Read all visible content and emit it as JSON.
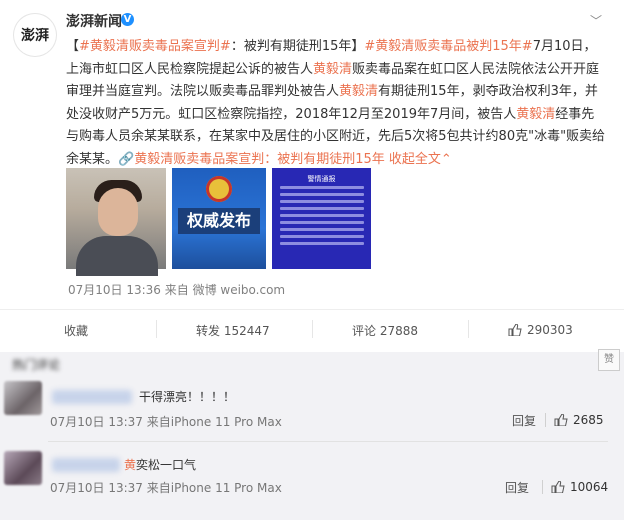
{
  "account": {
    "name": "澎湃新闻",
    "verified_mark": "V",
    "logo_text": "澎湃",
    "more_label": "﹀"
  },
  "post": {
    "segments": [
      {
        "t": "【",
        "c": "plain"
      },
      {
        "t": "#黄毅清贩卖毒品案宣判#",
        "c": "tag"
      },
      {
        "t": "：被判有期徒刑15年】",
        "c": "plain"
      },
      {
        "t": "#黄毅清贩卖毒品被判15年#",
        "c": "tag"
      },
      {
        "t": "7月10日，上海市虹口区人民检察院提起公诉的被告人",
        "c": "plain"
      },
      {
        "t": "黄毅清",
        "c": "tag"
      },
      {
        "t": "贩卖毒品案在虹口区人民法院依法公开开庭审理并当庭宣判。法院以贩卖毒品罪判处被告人",
        "c": "plain"
      },
      {
        "t": "黄毅清",
        "c": "tag"
      },
      {
        "t": "有期徒刑15年，剥夺政治权利3年，并处没收财产5万元。虹口区检察院指控，2018年12月至2019年7月间，被告人",
        "c": "plain"
      },
      {
        "t": "黄毅清",
        "c": "tag"
      },
      {
        "t": "经事先与购毒人员余某某联系，在某家中及居住的小区附近，先后5次将5包共计约80克\"冰毒\"贩卖给余某某。",
        "c": "plain"
      },
      {
        "t": "🔗黄毅清贩卖毒品案宣判：被判有期徒刑15年",
        "c": "tag"
      },
      {
        "t": " 收起全文",
        "c": "link"
      },
      {
        "t": "⌃",
        "c": "link"
      }
    ],
    "images": [
      {
        "name": "portrait-photo"
      },
      {
        "name": "authority-release-image",
        "text": "权威发布"
      },
      {
        "name": "police-notice-image",
        "text": "警情通报"
      }
    ],
    "meta": "07月10日 13:36  来自 微博 weibo.com"
  },
  "actions": {
    "favorite": "收藏",
    "repost": "转发 152447",
    "comment": "评论 27888",
    "like": "290303"
  },
  "comments_title": "热门评论",
  "comments": [
    {
      "text": "干得漂亮！！！！",
      "time": "07月10日 13:37 来自iPhone 11 Pro Max",
      "reply": "回复",
      "likes": "2685"
    },
    {
      "prefix": "黄",
      "text": "奕松一口气",
      "time": "07月10日 13:37 来自iPhone 11 Pro Max",
      "reply": "回复",
      "likes": "10064"
    }
  ],
  "zan_label": "赞"
}
